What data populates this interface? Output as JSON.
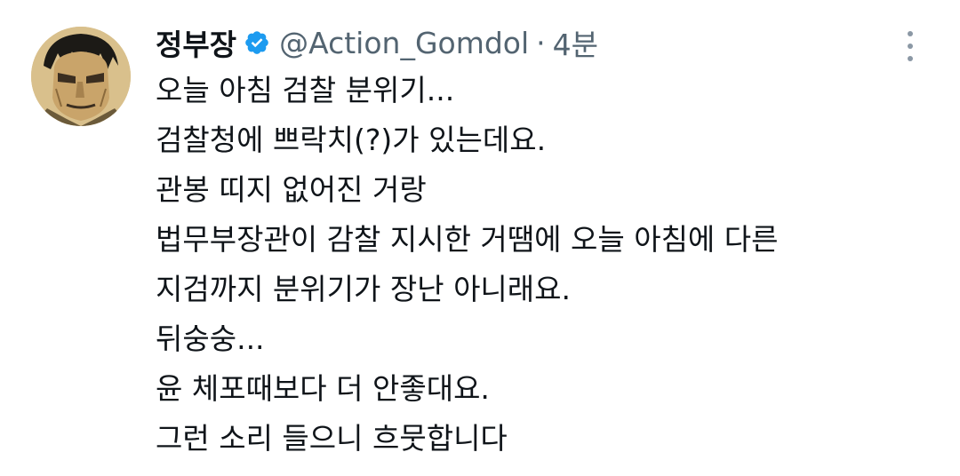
{
  "tweet": {
    "display_name": "정부장",
    "handle": "@Action_Gomdol",
    "separator": "·",
    "time": "4분",
    "verified_color": "#1d9bf0",
    "lines": [
      "오늘 아침 검찰 분위기...",
      "검찰청에 쁘락치(?)가 있는데요.",
      "관봉 띠지 없어진 거랑",
      "법무부장관이 감찰 지시한 거땜에 오늘 아침에 다른",
      "지검까지 분위기가 장난 아니래요.",
      "뒤숭숭...",
      "윤 체포때보다 더 안좋대요.",
      "그런 소리 들으니 흐뭇합니다"
    ]
  },
  "icons": {
    "avatar": "avatar-illustration",
    "verified": "verified-badge-icon",
    "more": "more-options-icon"
  }
}
